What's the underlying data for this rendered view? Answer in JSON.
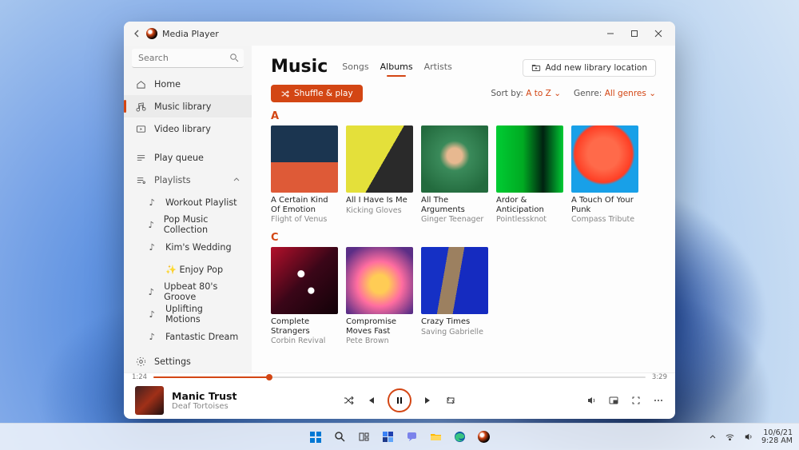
{
  "app": {
    "title": "Media Player"
  },
  "search": {
    "placeholder": "Search"
  },
  "sidebar": {
    "home": "Home",
    "music_library": "Music library",
    "video_library": "Video library",
    "play_queue": "Play queue",
    "playlists_header": "Playlists",
    "playlists": [
      "Workout Playlist",
      "Pop Music Collection",
      "Kim's Wedding",
      "✨ Enjoy Pop",
      "Upbeat 80's Groove",
      "Uplifting Motions",
      "Fantastic Dream"
    ],
    "settings": "Settings"
  },
  "header": {
    "title": "Music",
    "tabs": {
      "songs": "Songs",
      "albums": "Albums",
      "artists": "Artists"
    },
    "add_location": "Add new library location"
  },
  "toolbar": {
    "shuffle": "Shuffle & play",
    "sort_label": "Sort by:",
    "sort_value": "A to Z",
    "genre_label": "Genre:",
    "genre_value": "All genres"
  },
  "sections": {
    "A": [
      {
        "title": "A Certain Kind Of Emotion",
        "artist": "Flight of Venus"
      },
      {
        "title": "All I Have Is Me",
        "artist": "Kicking Gloves"
      },
      {
        "title": "All The Arguments",
        "artist": "Ginger Teenager"
      },
      {
        "title": "Ardor & Anticipation",
        "artist": "Pointlessknot"
      },
      {
        "title": "A Touch Of Your Punk",
        "artist": "Compass Tribute"
      }
    ],
    "C": [
      {
        "title": "Complete Strangers",
        "artist": "Corbin Revival"
      },
      {
        "title": "Compromise Moves Fast",
        "artist": "Pete Brown"
      },
      {
        "title": "Crazy Times",
        "artist": "Saving Gabrielle"
      }
    ]
  },
  "player": {
    "elapsed": "1:24",
    "total": "3:29",
    "song": "Manic Trust",
    "artist": "Deaf Tortoises"
  },
  "taskbar": {
    "date": "10/6/21",
    "time": "9:28 AM"
  }
}
